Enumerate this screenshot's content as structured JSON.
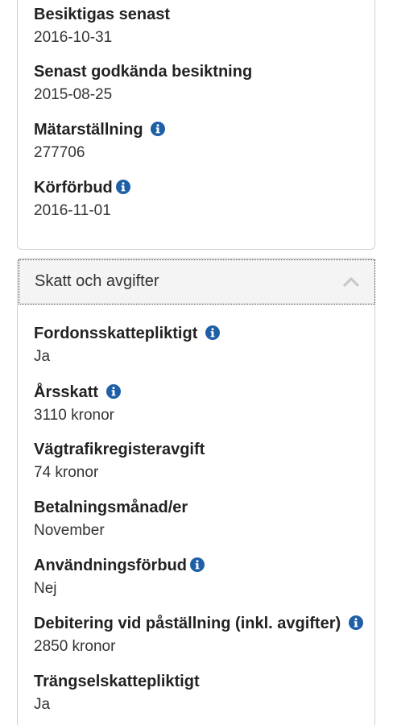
{
  "vehicle_section": {
    "fields": [
      {
        "label": "Besiktigas senast",
        "value": "2016-10-31",
        "link": false,
        "info": false
      },
      {
        "label": "Senast godkända besiktning",
        "value": "2015-08-25",
        "link": false,
        "info": false
      },
      {
        "label": "Mätarställning ",
        "value": "277706",
        "link": true,
        "info": true
      },
      {
        "label": "Körförbud",
        "value": "2016-11-01",
        "link": true,
        "info": true
      }
    ]
  },
  "tax_section": {
    "title": "Skatt och avgifter",
    "expanded": true,
    "fields": [
      {
        "label": "Fordonsskattepliktigt ",
        "value": "Ja",
        "link": true,
        "info": true
      },
      {
        "label": "Årsskatt ",
        "value": "3110 kronor",
        "link": true,
        "info": true
      },
      {
        "label": "Vägtrafikregisteravgift",
        "value": "74 kronor",
        "link": false,
        "info": false
      },
      {
        "label": "Betalningsmånad/er",
        "value": "November",
        "link": false,
        "info": false
      },
      {
        "label": "Användningsförbud",
        "value": "Nej",
        "link": true,
        "info": true
      },
      {
        "label": "Debitering vid påställning (inkl. avgifter) ",
        "value": "2850 kronor",
        "link": true,
        "info": true
      },
      {
        "label": "Trängselskattepliktigt",
        "value": "Ja",
        "link": false,
        "info": false
      }
    ]
  },
  "colors": {
    "link": "#1f5fa6",
    "text": "#222222",
    "header_bg": "#f4f4f4",
    "border": "#cfcfcf"
  },
  "icons": {
    "info": "info-circle-icon",
    "collapse": "chevron-up-icon"
  }
}
